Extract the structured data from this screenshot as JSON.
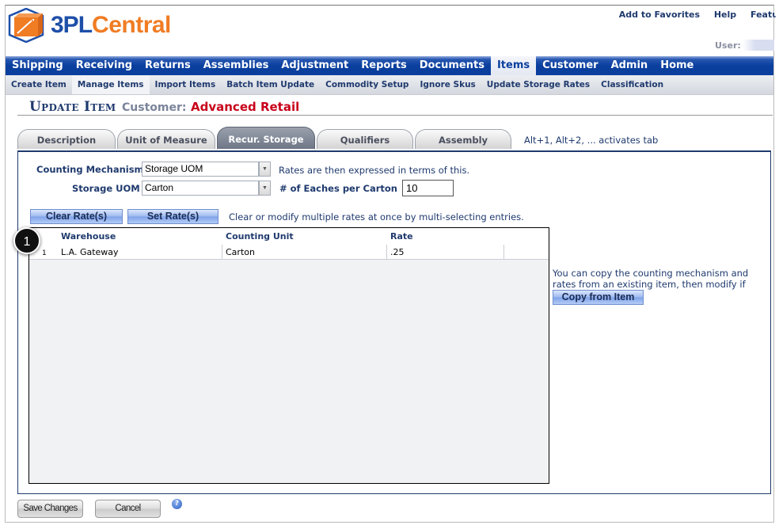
{
  "brand": {
    "part1": "3PL",
    "part2": "Central"
  },
  "top_links": [
    "Add to Favorites",
    "Help",
    "Featu"
  ],
  "user_label": "User:",
  "main_nav": [
    {
      "label": "Shipping",
      "active": false
    },
    {
      "label": "Receiving",
      "active": false
    },
    {
      "label": "Returns",
      "active": false
    },
    {
      "label": "Assemblies",
      "active": false
    },
    {
      "label": "Adjustment",
      "active": false
    },
    {
      "label": "Reports",
      "active": false
    },
    {
      "label": "Documents",
      "active": false
    },
    {
      "label": "Items",
      "active": true
    },
    {
      "label": "Customer",
      "active": false
    },
    {
      "label": "Admin",
      "active": false
    },
    {
      "label": "Home",
      "active": false
    }
  ],
  "sub_nav": [
    {
      "label": "Create Item",
      "active": false
    },
    {
      "label": "Manage Items",
      "active": true
    },
    {
      "label": "Import Items",
      "active": false
    },
    {
      "label": "Batch Item Update",
      "active": false
    },
    {
      "label": "Commodity Setup",
      "active": false
    },
    {
      "label": "Ignore Skus",
      "active": false
    },
    {
      "label": "Update Storage Rates",
      "active": false
    },
    {
      "label": "Classification",
      "active": false
    }
  ],
  "page": {
    "title": "Update Item",
    "customer_label": "Customer:",
    "customer_value": "Advanced Retail"
  },
  "tabs": [
    {
      "label": "Description",
      "active": false
    },
    {
      "label": "Unit of Measure",
      "active": false
    },
    {
      "label": "Recur. Storage",
      "active": true
    },
    {
      "label": "Qualifiers",
      "active": false
    },
    {
      "label": "Assembly",
      "active": false
    }
  ],
  "tab_hint": "Alt+1, Alt+2, ... activates tab",
  "form": {
    "counting_mechanism_label": "Counting Mechanism",
    "counting_mechanism_value": "Storage UOM",
    "counting_mechanism_hint": "Rates are then expressed in terms of this.",
    "storage_uom_label": "Storage UOM",
    "storage_uom_value": "Carton",
    "eaches_label": "# of Eaches per Carton",
    "eaches_value": "10"
  },
  "actions": {
    "clear_rates": "Clear Rate(s)",
    "set_rates": "Set Rate(s)",
    "hint": "Clear or modify multiple rates at once by multi-selecting entries."
  },
  "grid": {
    "columns": [
      "Warehouse",
      "Counting Unit",
      "Rate"
    ],
    "rows": [
      {
        "num": "1",
        "warehouse": "L.A. Gateway",
        "counting_unit": "Carton",
        "rate": ".25"
      }
    ]
  },
  "step_marker": "1",
  "copy": {
    "hint": "You can copy the counting mechanism and rates from an existing item, then modify if necessary.",
    "button": "Copy from Item"
  },
  "footer": {
    "save": "Save Changes",
    "cancel": "Cancel",
    "help_icon": "?"
  }
}
